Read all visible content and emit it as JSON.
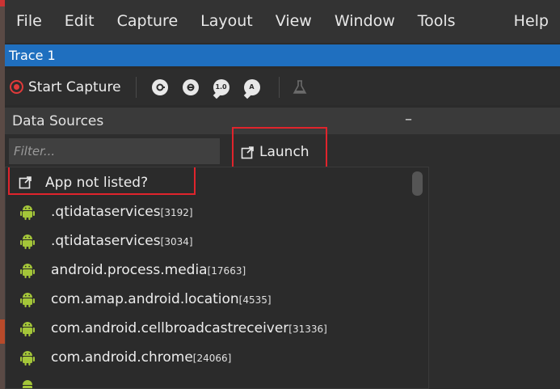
{
  "menu": [
    "File",
    "Edit",
    "Capture",
    "Layout",
    "View",
    "Window",
    "Tools",
    "Help"
  ],
  "window": {
    "title": "Trace 1"
  },
  "toolbar": {
    "start_capture_label": "Start Capture",
    "icons": [
      "capture-icon-1",
      "capture-icon-2",
      "capture-icon-speech-1.0",
      "capture-icon-speech-A",
      "flask-icon"
    ],
    "icon_texts": [
      "1.0",
      "A"
    ]
  },
  "data_sources": {
    "title": "Data Sources",
    "minimize_label": "–",
    "filter_placeholder": "Filter...",
    "launch_label": "Launch",
    "app_not_listed_label": "App not listed?",
    "apps": [
      {
        "name": ".qtidataservices",
        "pid": "[3192]"
      },
      {
        "name": ".qtidataservices",
        "pid": "[3034]"
      },
      {
        "name": "android.process.media",
        "pid": "[17663]"
      },
      {
        "name": "com.amap.android.location",
        "pid": "[4535]"
      },
      {
        "name": "com.android.cellbroadcastreceiver",
        "pid": "[31336]"
      },
      {
        "name": "com.android.chrome",
        "pid": "[24066]"
      },
      {
        "name": "",
        "pid": ""
      }
    ]
  },
  "colors": {
    "title_bar": "#1f6fbf",
    "highlight_border": "#e0242c",
    "record": "#e03a3a",
    "android": "#a4c639"
  }
}
